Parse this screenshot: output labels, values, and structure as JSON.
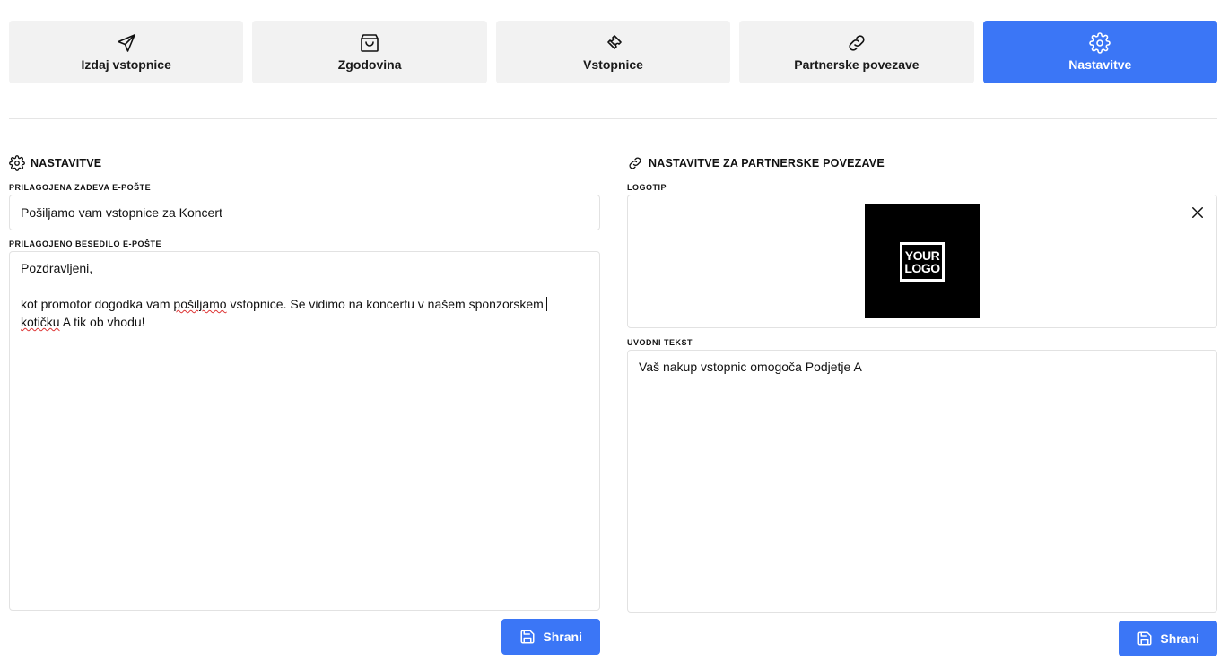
{
  "tabs": [
    {
      "label": "Izdaj vstopnice",
      "icon": "send-icon",
      "active": false
    },
    {
      "label": "Zgodovina",
      "icon": "shopping-bag-icon",
      "active": false
    },
    {
      "label": "Vstopnice",
      "icon": "ticket-icon",
      "active": false
    },
    {
      "label": "Partnerske povezave",
      "icon": "link-icon",
      "active": false
    },
    {
      "label": "Nastavitve",
      "icon": "gear-icon",
      "active": true
    }
  ],
  "colors": {
    "accent": "#3b76f6",
    "tab_bg": "#f2f2f2"
  },
  "settings": {
    "title": "NASTAVITVE",
    "subject_label": "PRILAGOJENA ZADEVA E-POŠTE",
    "subject_value": "Pošiljamo vam vstopnice za Koncert",
    "body_label": "PRILAGOJENO BESEDILO E-POŠTE",
    "body_line1": "Pozdravljeni,",
    "body_line3_a": "kot promotor dogodka vam ",
    "body_line3_spell": "pošiljamo",
    "body_line3_b": " vstopnice. Se vidimo na koncertu v našem sponzorskem",
    "body_line4_spell": "kotičku",
    "body_line4_b": " A tik ob vhodu!",
    "save_label": "Shrani"
  },
  "partner": {
    "title": "NASTAVITVE ZA PARTNERSKE POVEZAVE",
    "logo_label": "LOGOTIP",
    "logo_text_1": "YOUR",
    "logo_text_2": "LOGO",
    "intro_label": "UVODNI TEKST",
    "intro_value": "Vaš nakup vstopnic omogoča Podjetje A",
    "save_label": "Shrani"
  }
}
